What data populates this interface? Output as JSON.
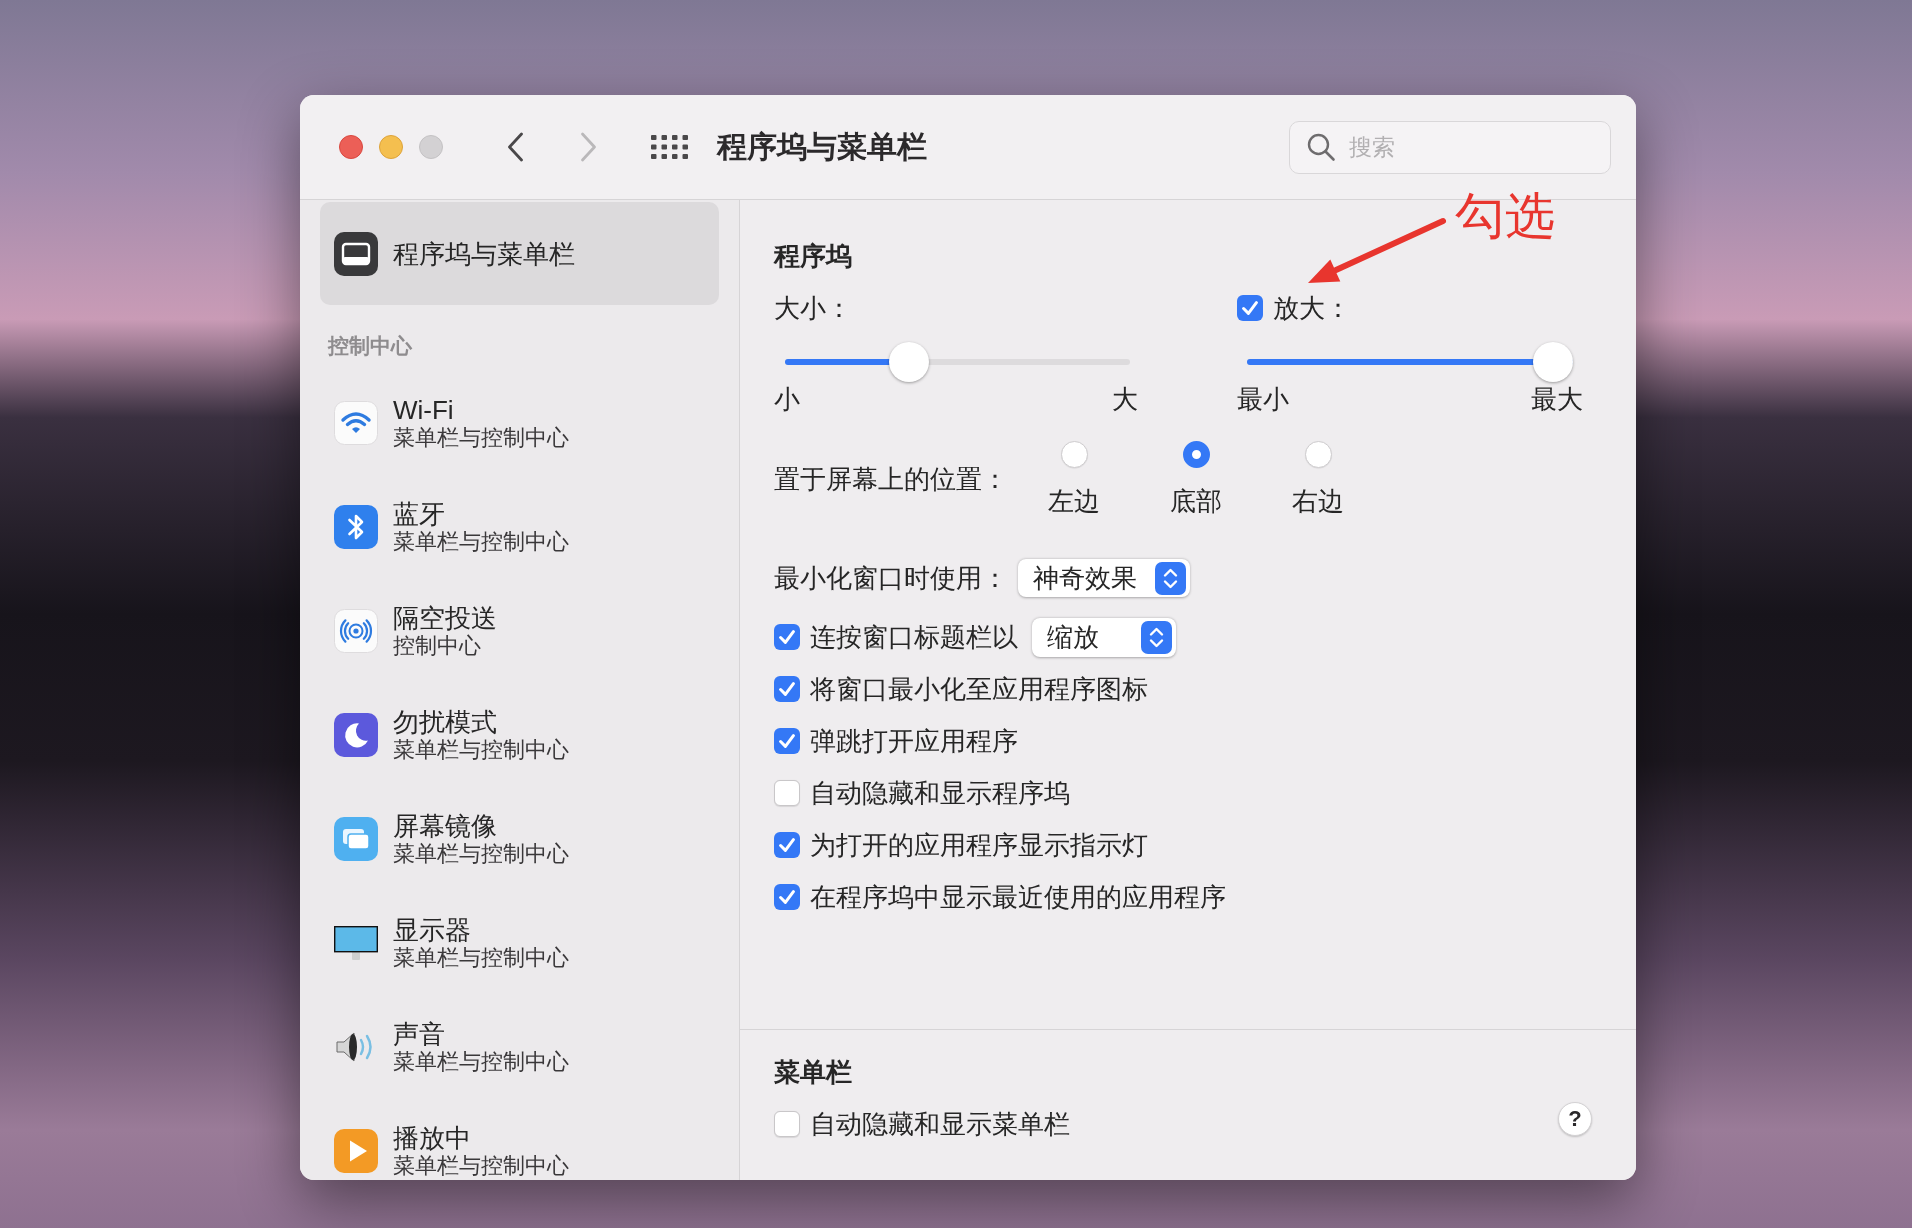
{
  "window": {
    "title": "程序坞与菜单栏",
    "zoom_button": {
      "disabled": true
    }
  },
  "toolbar": {
    "back": {
      "disabled": false
    },
    "forward": {
      "disabled": true
    },
    "search": {
      "placeholder": "搜索"
    }
  },
  "sidebar": {
    "items": [
      {
        "kind": "dock",
        "title": "程序坞与菜单栏",
        "selected": true
      }
    ],
    "sections": [
      {
        "heading": "控制中心",
        "items": [
          {
            "kind": "wifi",
            "title": "Wi-Fi",
            "subtitle": "菜单栏与控制中心",
            "selected": false
          },
          {
            "kind": "bluetooth",
            "title": "蓝牙",
            "subtitle": "菜单栏与控制中心",
            "selected": false
          },
          {
            "kind": "airdrop",
            "title": "隔空投送",
            "subtitle": "控制中心",
            "selected": false
          },
          {
            "kind": "moon",
            "title": "勿扰模式",
            "subtitle": "菜单栏与控制中心",
            "selected": false
          },
          {
            "kind": "mirroring",
            "title": "屏幕镜像",
            "subtitle": "菜单栏与控制中心",
            "selected": false
          },
          {
            "kind": "display",
            "title": "显示器",
            "subtitle": "菜单栏与控制中心",
            "selected": false
          },
          {
            "kind": "sound",
            "title": "声音",
            "subtitle": "菜单栏与控制中心",
            "selected": false
          },
          {
            "kind": "playing",
            "title": "播放中",
            "subtitle": "菜单栏与控制中心",
            "selected": false
          }
        ]
      }
    ]
  },
  "dock": {
    "heading": "程序坞",
    "size": {
      "label": "大小：",
      "level": 0.34,
      "min_label": "小",
      "max_label": "大"
    },
    "magnification": {
      "label": "放大：",
      "checked": true,
      "level": 1,
      "min_label": "最小",
      "max_label": "最大"
    },
    "position": {
      "label": "置于屏幕上的位置：",
      "options": [
        {
          "label": "左边",
          "selected": false
        },
        {
          "label": "底部",
          "selected": true
        },
        {
          "label": "右边",
          "selected": false
        }
      ]
    },
    "minimize_effect": {
      "label": "最小化窗口时使用：",
      "value": "神奇效果"
    },
    "options": [
      {
        "kind": "popup",
        "label": "连按窗口标题栏以",
        "checked": true,
        "value": "缩放"
      },
      {
        "kind": "plain",
        "label": "将窗口最小化至应用程序图标",
        "checked": true
      },
      {
        "kind": "plain",
        "label": "弹跳打开应用程序",
        "checked": true
      },
      {
        "kind": "plain",
        "label": "自动隐藏和显示程序坞",
        "checked": false
      },
      {
        "kind": "plain",
        "label": "为打开的应用程序显示指示灯",
        "checked": true
      },
      {
        "kind": "plain",
        "label": "在程序坞中显示最近使用的应用程序",
        "checked": true
      }
    ]
  },
  "menu_bar": {
    "heading": "菜单栏",
    "options": [
      {
        "label": "自动隐藏和显示菜单栏",
        "checked": false
      }
    ]
  },
  "help_button": {
    "label": "?"
  },
  "annotation": {
    "text": "勾选"
  }
}
